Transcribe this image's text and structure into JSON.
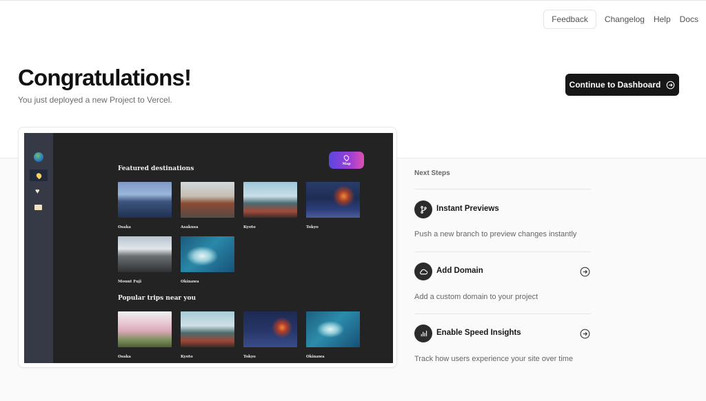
{
  "nav": {
    "feedback": "Feedback",
    "changelog": "Changelog",
    "help": "Help",
    "docs": "Docs"
  },
  "header": {
    "title": "Congratulations!",
    "subtitle": "You just deployed a new Project to Vercel.",
    "cta_label": "Continue to Dashboard",
    "cta_icon": "arrow-right-circle-icon"
  },
  "preview": {
    "map_button": "Map",
    "featured_title": "Featured destinations",
    "featured": [
      {
        "label": "Osaka"
      },
      {
        "label": "Asakusa"
      },
      {
        "label": "Kyoto"
      },
      {
        "label": "Tokyo"
      },
      {
        "label": "Mount Fuji"
      },
      {
        "label": "Okinawa"
      }
    ],
    "popular_title": "Popular trips near you",
    "popular": [
      {
        "label": "Osaka"
      },
      {
        "label": "Kyoto"
      },
      {
        "label": "Tokyo"
      },
      {
        "label": "Okinawa"
      }
    ]
  },
  "next_steps": {
    "heading": "Next Steps",
    "items": [
      {
        "title": "Instant Previews",
        "description": "Push a new branch to preview changes instantly",
        "icon": "git-branch-icon",
        "has_arrow": false
      },
      {
        "title": "Add Domain",
        "description": "Add a custom domain to your project",
        "icon": "cloud-icon",
        "has_arrow": true
      },
      {
        "title": "Enable Speed Insights",
        "description": "Track how users experience your site over time",
        "icon": "bar-chart-icon",
        "has_arrow": true
      }
    ]
  },
  "colors": {
    "primary_button": "#171717",
    "app_background": "#232323",
    "app_sidebar": "#363a47",
    "map_button_start": "#5b47e0",
    "map_button_end": "#e04fb0"
  }
}
